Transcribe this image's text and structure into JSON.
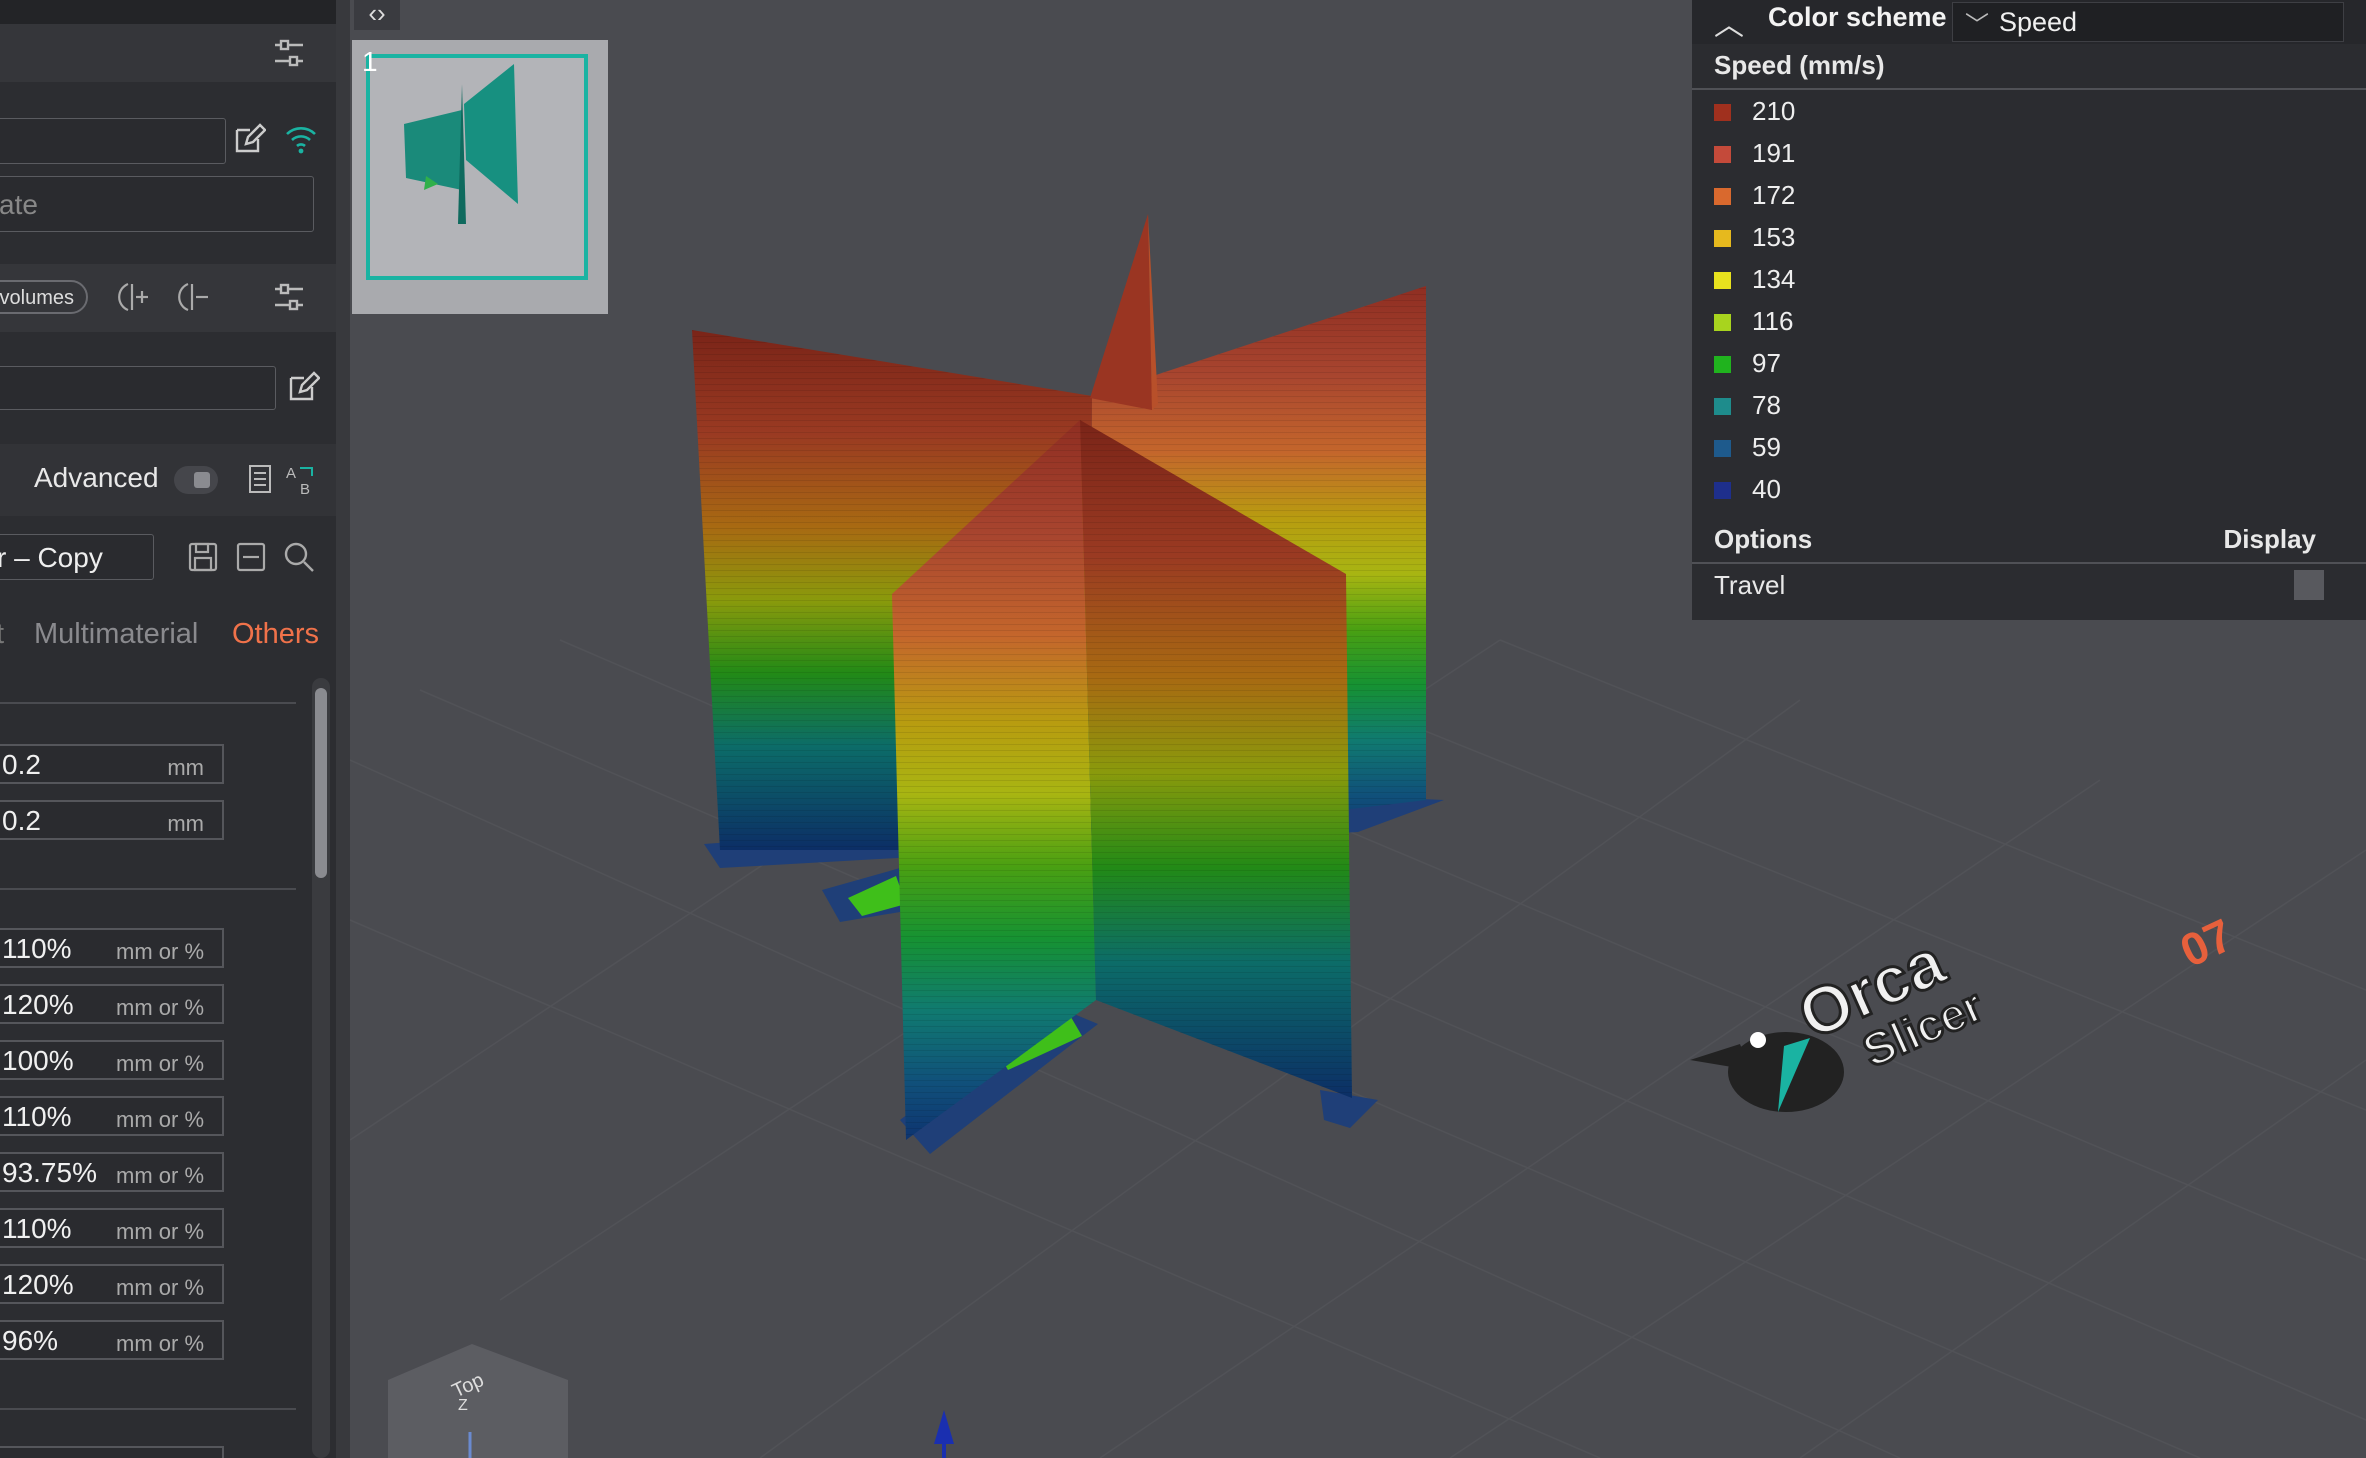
{
  "sidebar": {
    "plate_field_fragment": "ate",
    "volumes_pill": "volumes",
    "advanced_label": "Advanced",
    "preset_name_fragment": "r – Copy",
    "tabs": [
      {
        "label": "t",
        "active": false
      },
      {
        "label": "Multimaterial",
        "active": false
      },
      {
        "label": "Others",
        "active": true
      }
    ],
    "params": [
      {
        "value": "0.2",
        "unit": "mm"
      },
      {
        "value": "0.2",
        "unit": "mm"
      },
      {
        "value": "110%",
        "unit": "mm or %"
      },
      {
        "value": "120%",
        "unit": "mm or %"
      },
      {
        "value": "100%",
        "unit": "mm or %"
      },
      {
        "value": "110%",
        "unit": "mm or %"
      },
      {
        "value": "93.75%",
        "unit": "mm or %"
      },
      {
        "value": "110%",
        "unit": "mm or %"
      },
      {
        "value": "120%",
        "unit": "mm or %"
      },
      {
        "value": "96%",
        "unit": "mm or %"
      }
    ]
  },
  "plate_thumbnail": {
    "number": "1"
  },
  "legend": {
    "color_scheme_label": "Color scheme",
    "color_scheme_value": "Speed",
    "title": "Speed (mm/s)",
    "items": [
      {
        "label": "210",
        "color": "#a0301e"
      },
      {
        "label": "191",
        "color": "#c44a3a"
      },
      {
        "label": "172",
        "color": "#d9692e"
      },
      {
        "label": "153",
        "color": "#e6b91e"
      },
      {
        "label": "134",
        "color": "#e8e21e"
      },
      {
        "label": "116",
        "color": "#a8d41e"
      },
      {
        "label": "97",
        "color": "#20b31e"
      },
      {
        "label": "78",
        "color": "#1e8c8c"
      },
      {
        "label": "59",
        "color": "#1e5a8c"
      },
      {
        "label": "40",
        "color": "#1e2f8c"
      }
    ],
    "options_label": "Options",
    "display_label": "Display",
    "travel_label": "Travel"
  },
  "viewport": {
    "logo_line1": "Orca",
    "logo_line2": "Slicer",
    "plate_label": "07",
    "view_cube_label": "Top",
    "axis_label": "Z"
  }
}
